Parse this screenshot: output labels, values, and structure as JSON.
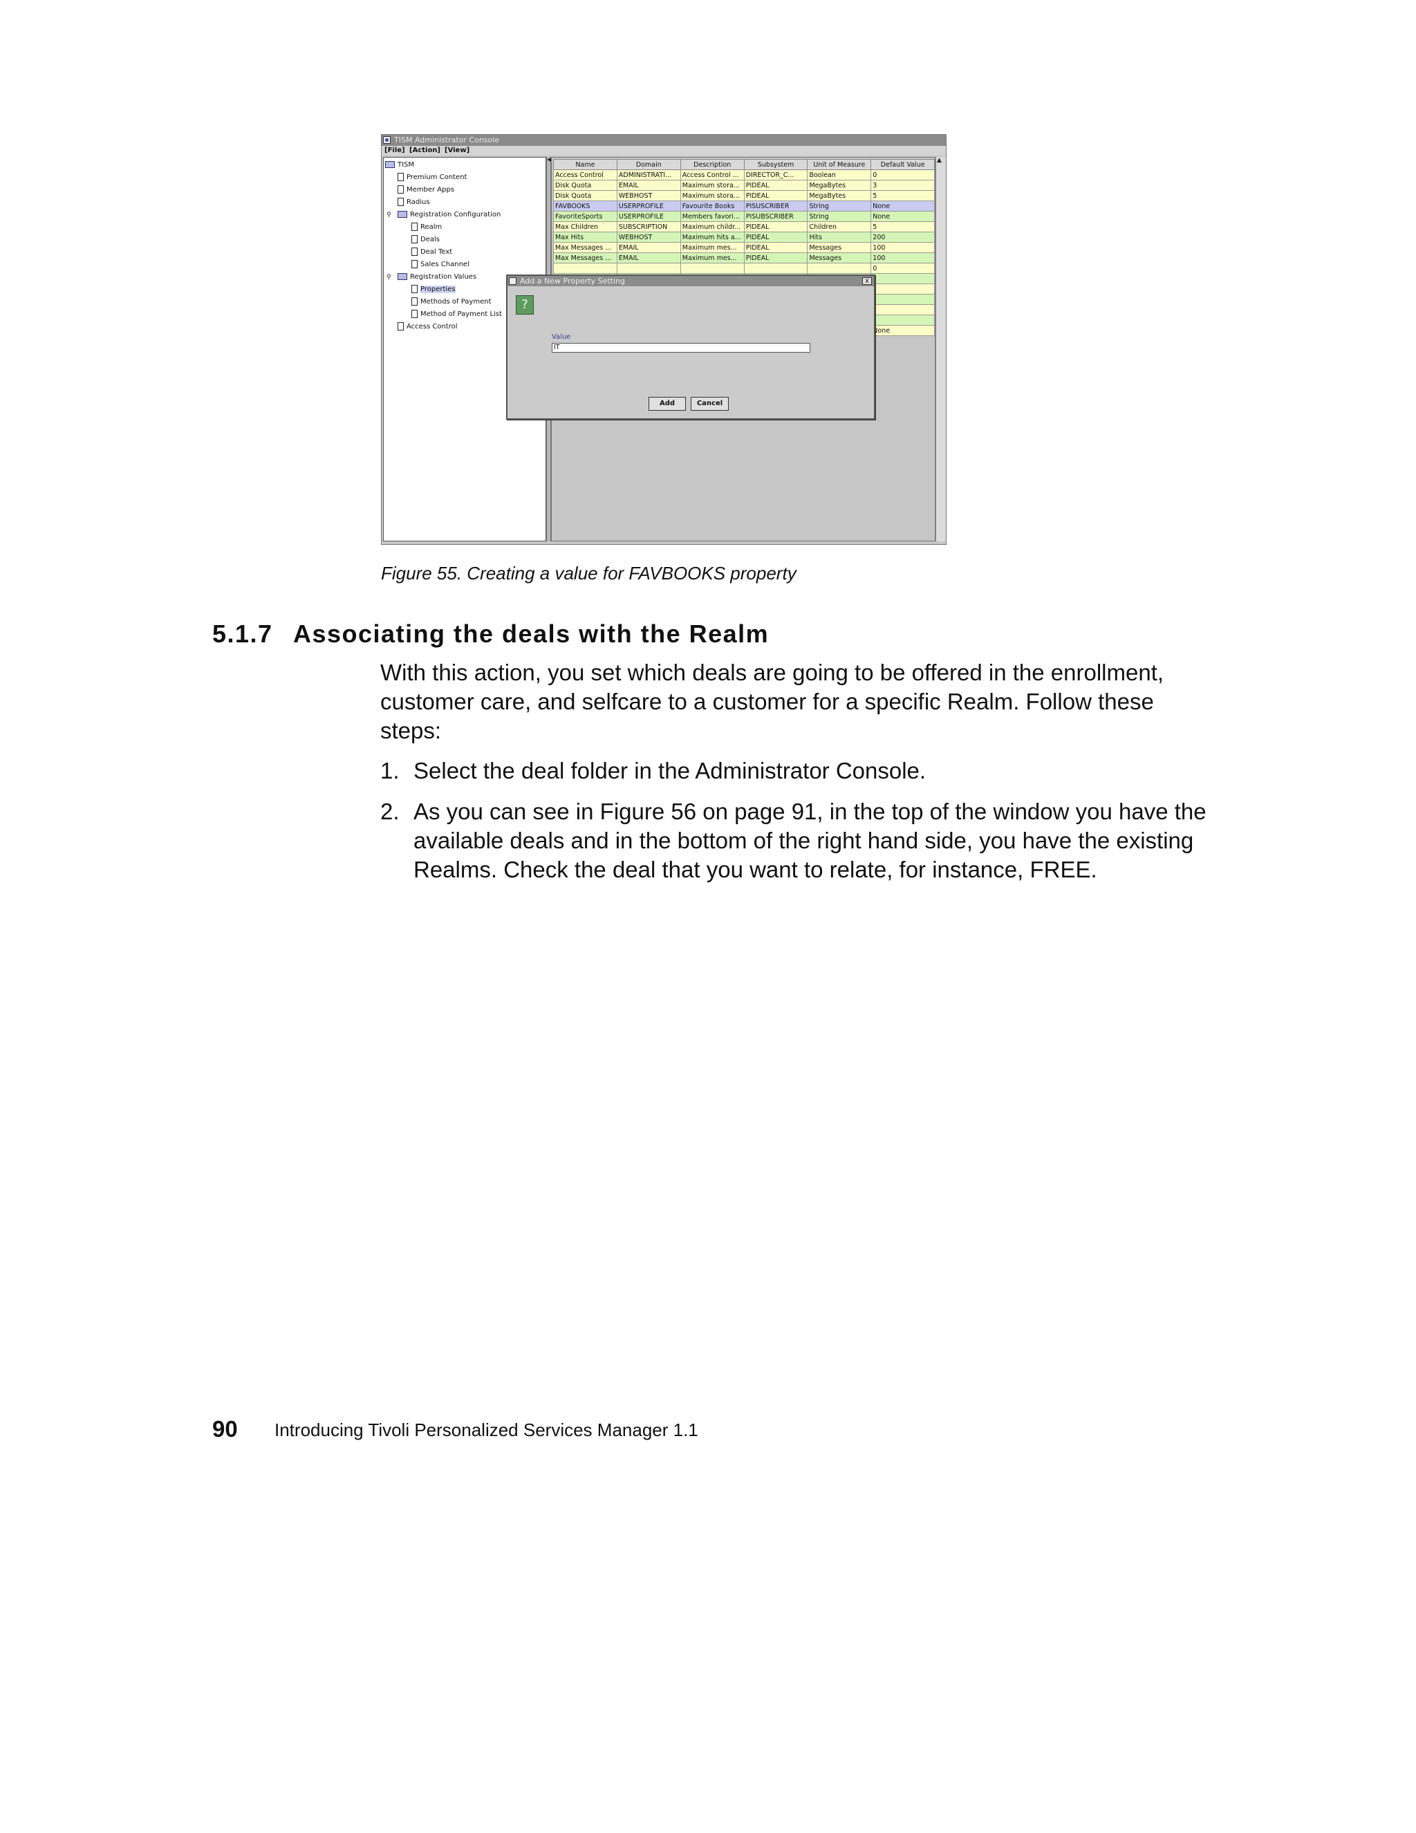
{
  "figure": {
    "caption": "Figure 55.  Creating a value for FAVBOOKS property",
    "window": {
      "title": "TISM Administrator Console",
      "menu": [
        "[File]",
        "[Action]",
        "[View]"
      ]
    },
    "tree": [
      {
        "label": "TISM",
        "icon": "folder-icon"
      },
      {
        "label": "Premium Content",
        "icon": "document-icon"
      },
      {
        "label": "Member Apps",
        "icon": "document-icon"
      },
      {
        "label": "Radius",
        "icon": "document-icon"
      },
      {
        "label": "Registration Configuration",
        "icon": "folder-icon"
      },
      {
        "label": "Realm",
        "icon": "document-icon"
      },
      {
        "label": "Deals",
        "icon": "document-icon"
      },
      {
        "label": "Deal Text",
        "icon": "document-icon"
      },
      {
        "label": "Sales Channel",
        "icon": "document-icon"
      },
      {
        "label": "Registration Values",
        "icon": "folder-icon"
      },
      {
        "label": "Properties",
        "icon": "document-icon"
      },
      {
        "label": "Methods of Payment",
        "icon": "document-icon"
      },
      {
        "label": "Method of Payment List",
        "icon": "document-icon"
      },
      {
        "label": "Access Control",
        "icon": "document-icon"
      }
    ],
    "table": {
      "columns": [
        "Name",
        "Domain",
        "Description",
        "Subsystem",
        "Unit of Measure",
        "Default Value"
      ],
      "rows": [
        [
          "Access Control",
          "ADMINISTRATI...",
          "Access Control ...",
          "DIRECTOR_C...",
          "Boolean",
          "0"
        ],
        [
          "Disk Quota",
          "EMAIL",
          "Maximum stora...",
          "PIDEAL",
          "MegaBytes",
          "3"
        ],
        [
          "Disk Quota",
          "WEBHOST",
          "Maximum stora...",
          "PIDEAL",
          "MegaBytes",
          "5"
        ],
        [
          "FAVBOOKS",
          "USERPROFILE",
          "Favourite Books",
          "PISUSCRIBER",
          "String",
          "None"
        ],
        [
          "FavoriteSports",
          "USERPROFILE",
          "Members favori...",
          "PISUBSCRIBER",
          "String",
          "None"
        ],
        [
          "Max Children",
          "SUBSCRIPTION",
          "Maximum childr...",
          "PIDEAL",
          "Children",
          "5"
        ],
        [
          "Max Hits",
          "WEBHOST",
          "Maximum hits a...",
          "PIDEAL",
          "Hits",
          "200"
        ],
        [
          "Max Messages ...",
          "EMAIL",
          "Maximum mes...",
          "PIDEAL",
          "Messages",
          "100"
        ],
        [
          "Max Messages ...",
          "EMAIL",
          "Maximum mes...",
          "PIDEAL",
          "Messages",
          "100"
        ],
        [
          "",
          "",
          "",
          "",
          "",
          "0"
        ],
        [
          "",
          "",
          "",
          "",
          "",
          ""
        ],
        [
          "",
          "",
          "",
          "",
          "",
          ""
        ],
        [
          "",
          "",
          "",
          "",
          "",
          ""
        ],
        [
          "",
          "",
          "",
          "",
          "",
          ""
        ],
        [
          "",
          "",
          "",
          "",
          "",
          ""
        ],
        [
          "",
          "",
          "",
          "",
          "",
          "None"
        ]
      ]
    },
    "dialog": {
      "title": "Add a New Property Setting",
      "field_label": "Value",
      "field_value": "IT",
      "add_label": "Add",
      "cancel_label": "Cancel",
      "close_glyph": "x"
    }
  },
  "section": {
    "number": "5.1.7",
    "title": "Associating the deals with the Realm"
  },
  "intro": "With this action, you set which deals are going to be offered in the enrollment, customer care, and selfcare to a customer for a specific Realm. Follow these steps:",
  "steps": [
    {
      "num": "1.",
      "text": "Select the deal folder in the Administrator Console."
    },
    {
      "num": "2.",
      "text": "As you can see in Figure 56 on page 91, in the top of the window you have the available deals and in the bottom of the right hand side, you have the existing Realms. Check the deal that you want to relate, for instance, FREE."
    }
  ],
  "footer": {
    "page_number": "90",
    "book_title": "Introducing Tivoli Personalized Services Manager 1.1"
  }
}
